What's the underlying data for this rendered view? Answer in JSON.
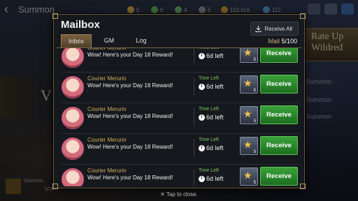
{
  "background": {
    "screen_title": "Summon",
    "resources": [
      "5",
      "0",
      "4",
      "5",
      "110,416",
      "112"
    ],
    "banner_text": "Rate Up\nWildred",
    "side_items": [
      "Summon",
      "Summon",
      "Summon"
    ],
    "bottom_left": {
      "title": "Summon",
      "count": "5/20"
    }
  },
  "modal": {
    "title": "Mailbox",
    "receive_all_label": "Receive All",
    "tabs": [
      {
        "label": "Inbox",
        "active": true
      },
      {
        "label": "GM",
        "active": false
      },
      {
        "label": "Log",
        "active": false
      }
    ],
    "mail_label": "Mail",
    "mail_count": "5/100",
    "messages": [
      {
        "sender": "Courier Merurin",
        "text": "Wow! Here's your Day 18 Reward!",
        "time_label": "Time Left",
        "time_value": "6d left",
        "reward_icon": "star-icon",
        "reward_qty": "5",
        "button": "Receive"
      },
      {
        "sender": "Courier Merurin",
        "text": "Wow! Here's your Day 18 Reward!",
        "time_label": "Time Left",
        "time_value": "6d left",
        "reward_icon": "star-icon",
        "reward_qty": "5",
        "button": "Receive"
      },
      {
        "sender": "Courier Merurin",
        "text": "Wow! Here's your Day 18 Reward!",
        "time_label": "Time Left",
        "time_value": "6d left",
        "reward_icon": "star-icon",
        "reward_qty": "5",
        "button": "Receive"
      },
      {
        "sender": "Courier Merurin",
        "text": "Wow! Here's your Day 18 Reward!",
        "time_label": "Time Left",
        "time_value": "6d left",
        "reward_icon": "star-icon",
        "reward_qty": "5",
        "button": "Receive"
      },
      {
        "sender": "Courier Merurin",
        "text": "Wow! Here's your Day 18 Reward!",
        "time_label": "Time Left",
        "time_value": "6d left",
        "reward_icon": "star-icon",
        "reward_qty": "5",
        "button": "Receive"
      }
    ]
  },
  "footer": {
    "tap_close": "Tap to close."
  },
  "colors": {
    "accent_gold": "#c9b27a",
    "button_green": "#2e8c30",
    "time_green": "#7ec85b"
  }
}
